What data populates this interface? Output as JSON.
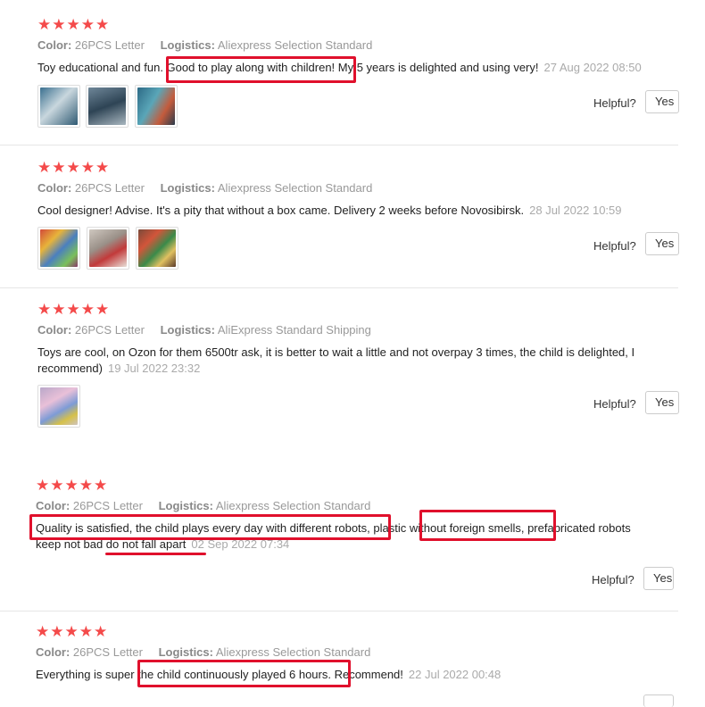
{
  "labels": {
    "color": "Color:",
    "logistics": "Logistics:",
    "helpful": "Helpful?",
    "yes": "Yes"
  },
  "reviews": [
    {
      "stars": "★★★★★",
      "color_value": "26PCS Letter",
      "logistics_value": "Aliexpress Selection Standard",
      "text": "Toy educational and fun. Good to play along with children! My 5 years is delighted and using very!",
      "date": "27 Aug 2022 08:50"
    },
    {
      "stars": "★★★★★",
      "color_value": "26PCS Letter",
      "logistics_value": "Aliexpress Selection Standard",
      "text": "Cool designer! Advise. It's a pity that without a box came. Delivery 2 weeks before Novosibirsk.",
      "date": "28 Jul 2022 10:59"
    },
    {
      "stars": "★★★★★",
      "color_value": "26PCS Letter",
      "logistics_value": "AliExpress Standard Shipping",
      "text_line1": "Toys are cool, on Ozon for them 6500tr ask, it is better to wait a little and not overpay 3 times, the child is delighted, I",
      "text_line2": "recommend)",
      "date": "19 Jul 2022 23:32"
    },
    {
      "stars": "★★★★★",
      "color_value": "26PCS Letter",
      "logistics_value": "Aliexpress Selection Standard",
      "text_line1": "Quality is satisfied, the child plays every day with different robots, plastic without foreign smells, prefabricated robots",
      "text_line2": "keep not bad do not fall apart",
      "date": "02 Sep 2022 07:34"
    },
    {
      "stars": "★★★★★",
      "color_value": "26PCS Letter",
      "logistics_value": "Aliexpress Selection Standard",
      "text": "Everything is super the child continuously played 6 hours. Recommend!",
      "date": "22 Jul 2022 00:48"
    }
  ],
  "colors": {
    "star": "#f44a4a",
    "highlight": "#e0102c"
  }
}
